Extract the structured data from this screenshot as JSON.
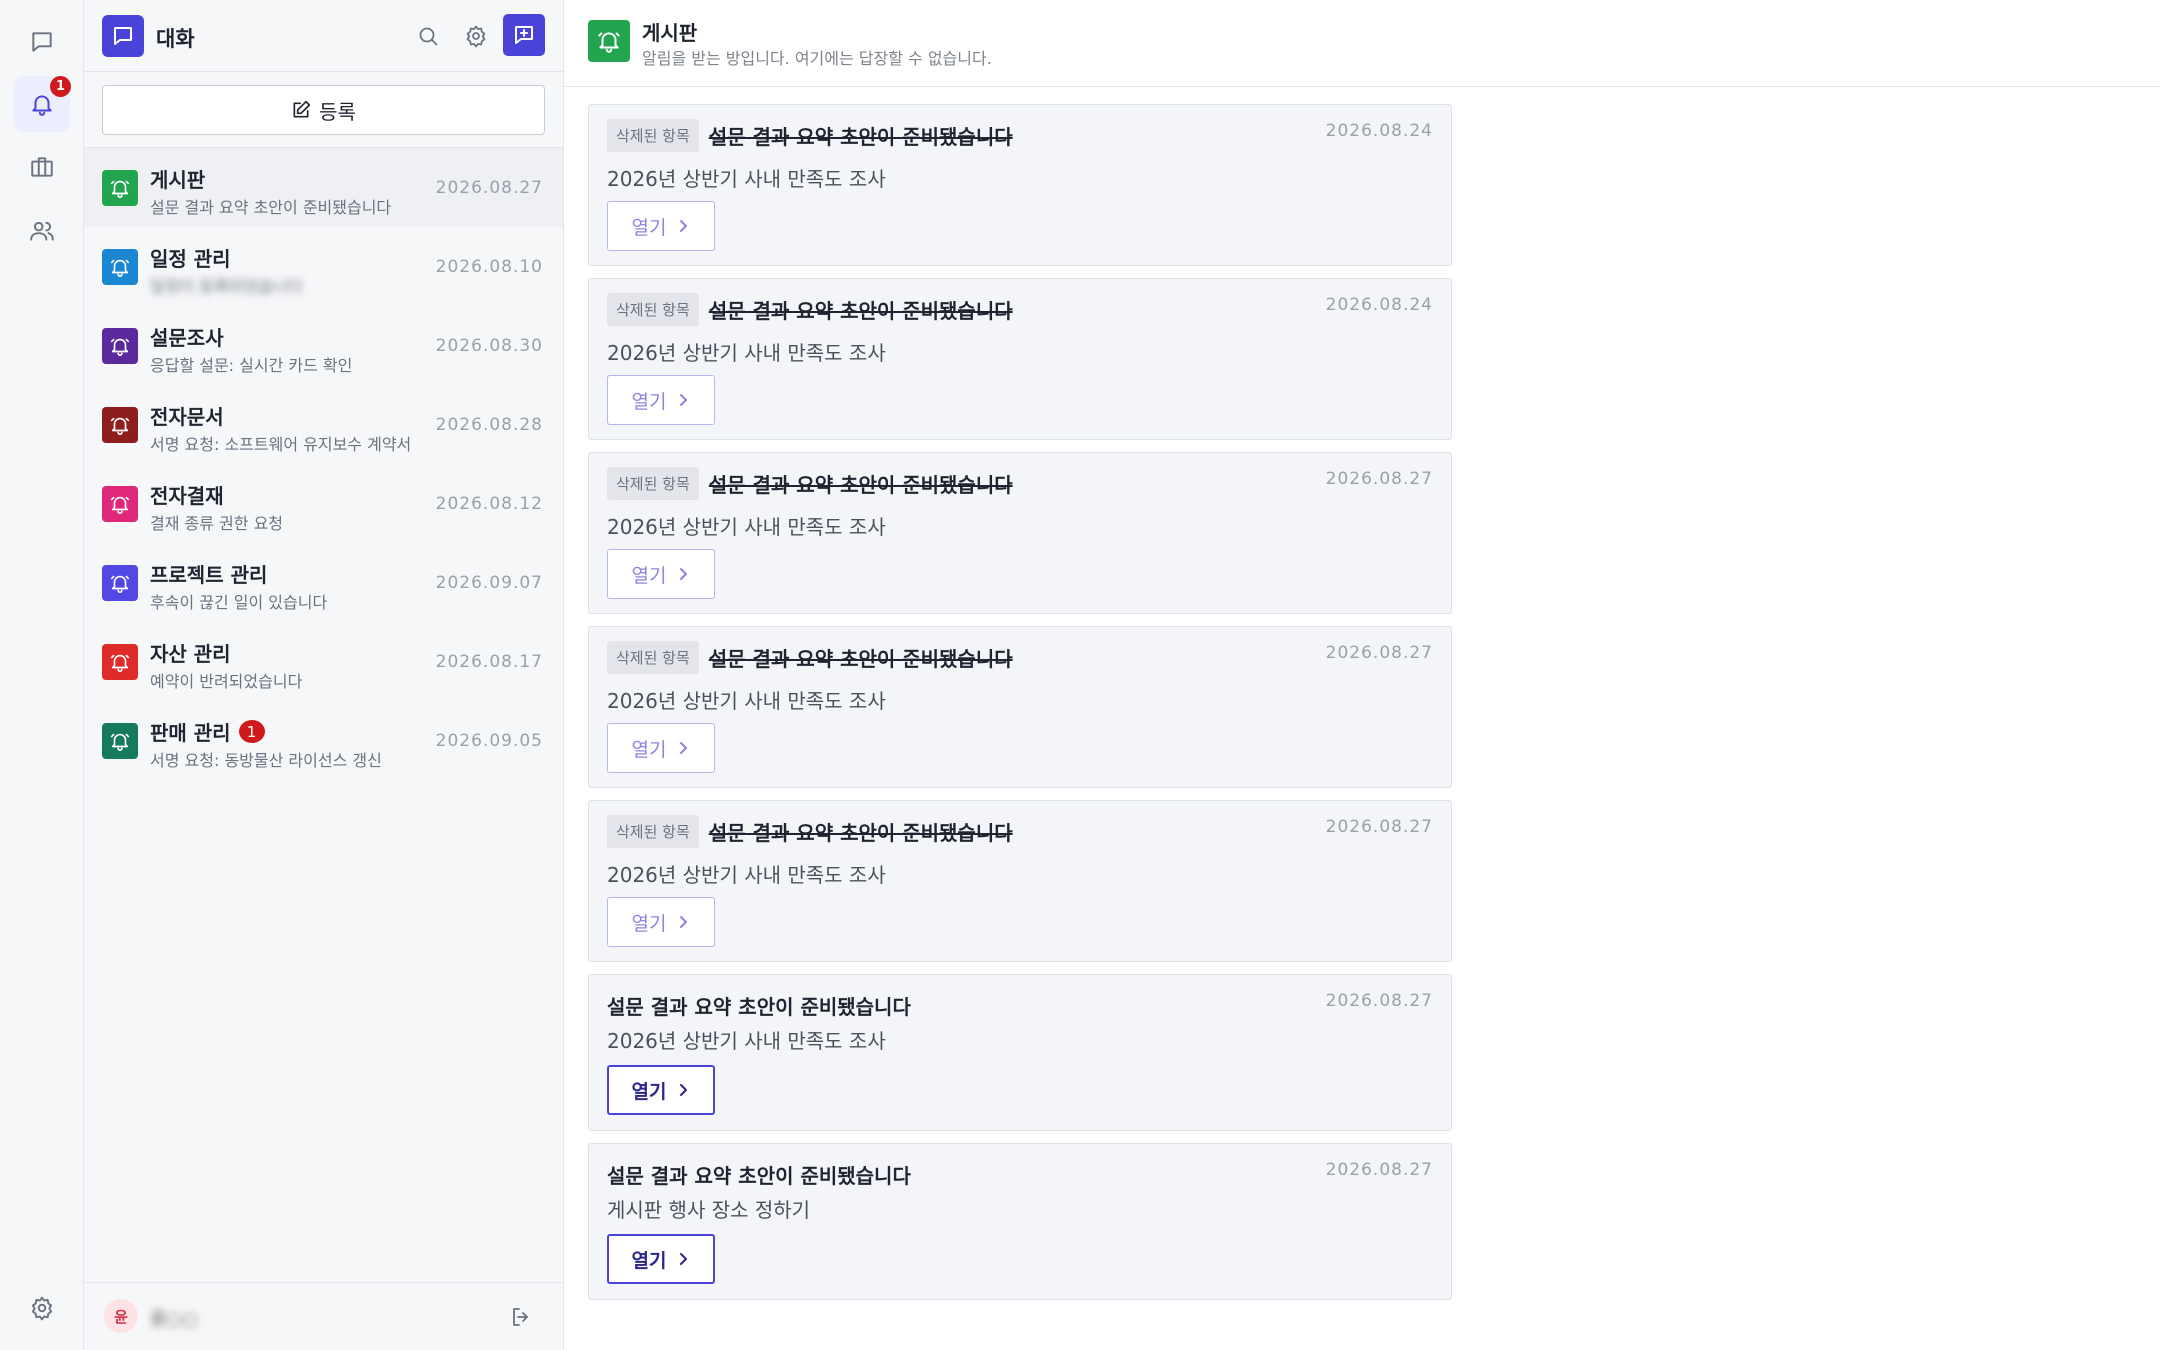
{
  "rail": {
    "notification_badge": "1"
  },
  "panel": {
    "title": "대화",
    "register_label": "등록",
    "footer": {
      "avatar_initial": "윤",
      "user_name": "윤○○"
    }
  },
  "rooms": [
    {
      "name": "게시판",
      "sub": "설문 결과 요약 초안이 준비됐습니다",
      "date": "2026.08.27",
      "color": "#22a54e",
      "badge": ""
    },
    {
      "name": "일정 관리",
      "sub": "일정이 등록되었습니다",
      "date": "2026.08.10",
      "color": "#1b86d1",
      "badge": "",
      "blurred": true
    },
    {
      "name": "설문조사",
      "sub": "응답할 설문: 실시간 카드 확인",
      "date": "2026.08.30",
      "color": "#5a2a9c",
      "badge": ""
    },
    {
      "name": "전자문서",
      "sub": "서명 요청: 소프트웨어 유지보수 계약서",
      "date": "2026.08.28",
      "color": "#8e1d1d",
      "badge": ""
    },
    {
      "name": "전자결재",
      "sub": "결재 종류 권한 요청",
      "date": "2026.08.12",
      "color": "#e0287a",
      "badge": ""
    },
    {
      "name": "프로젝트 관리",
      "sub": "후속이 끊긴 일이 있습니다",
      "date": "2026.09.07",
      "color": "#5248e3",
      "badge": ""
    },
    {
      "name": "자산 관리",
      "sub": "예약이 반려되었습니다",
      "date": "2026.08.17",
      "color": "#e02b2b",
      "badge": ""
    },
    {
      "name": "판매 관리",
      "sub": "서명 요청: 동방물산 라이선스 갱신",
      "date": "2026.09.05",
      "color": "#167a5e",
      "badge": "1"
    }
  ],
  "main": {
    "title": "게시판",
    "description": "알림을 받는 방입니다. 여기에는 답장할 수 없습니다.",
    "accent": "#22a54e"
  },
  "cards": [
    {
      "deleted": true,
      "tag": "삭제된 항목",
      "title": "설문 결과 요약 초안이 준비됐습니다",
      "body": "2026년 상반기 사내 만족도 조사",
      "date": "2026.08.24",
      "button": "열기"
    },
    {
      "deleted": true,
      "tag": "삭제된 항목",
      "title": "설문 결과 요약 초안이 준비됐습니다",
      "body": "2026년 상반기 사내 만족도 조사",
      "date": "2026.08.24",
      "button": "열기"
    },
    {
      "deleted": true,
      "tag": "삭제된 항목",
      "title": "설문 결과 요약 초안이 준비됐습니다",
      "body": "2026년 상반기 사내 만족도 조사",
      "date": "2026.08.27",
      "button": "열기"
    },
    {
      "deleted": true,
      "tag": "삭제된 항목",
      "title": "설문 결과 요약 초안이 준비됐습니다",
      "body": "2026년 상반기 사내 만족도 조사",
      "date": "2026.08.27",
      "button": "열기"
    },
    {
      "deleted": true,
      "tag": "삭제된 항목",
      "title": "설문 결과 요약 초안이 준비됐습니다",
      "body": "2026년 상반기 사내 만족도 조사",
      "date": "2026.08.27",
      "button": "열기"
    },
    {
      "deleted": false,
      "tag": "",
      "title": "설문 결과 요약 초안이 준비됐습니다",
      "body": "2026년 상반기 사내 만족도 조사",
      "date": "2026.08.27",
      "button": "열기"
    },
    {
      "deleted": false,
      "tag": "",
      "title": "설문 결과 요약 초안이 준비됐습니다",
      "body": "게시판 행사 장소 정하기",
      "date": "2026.08.27",
      "button": "열기"
    }
  ],
  "icons": {
    "rail": [
      "chat-icon",
      "bell-icon",
      "briefcase-icon",
      "users-icon",
      "settings-icon"
    ],
    "header": [
      "search-icon",
      "gear-icon",
      "new-chat-icon"
    ],
    "footer": [
      "logout-icon"
    ]
  }
}
